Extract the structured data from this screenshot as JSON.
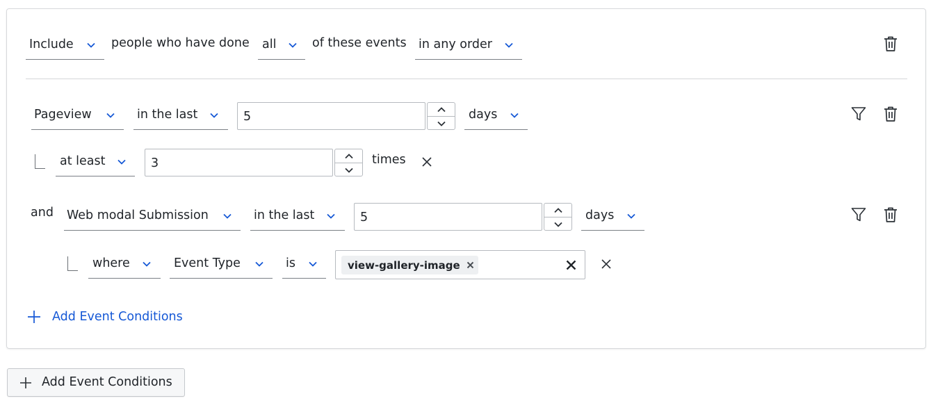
{
  "header": {
    "include_select": "Include",
    "text_people": "people who have done",
    "quantifier_select": "all",
    "text_events": "of these events",
    "order_select": "in any order"
  },
  "event1": {
    "event_select": "Pageview",
    "time_select": "in the last",
    "time_value": "5",
    "unit_select": "days",
    "frequency": {
      "operator_select": "at least",
      "count_value": "3",
      "suffix": "times"
    }
  },
  "event2": {
    "connector": "and",
    "event_select": "Web modal Submission",
    "time_select": "in the last",
    "time_value": "5",
    "unit_select": "days",
    "condition": {
      "where_select": "where",
      "property_select": "Event Type",
      "operator_select": "is",
      "chips": [
        "view-gallery-image"
      ]
    }
  },
  "inner_add_label": "Add Event Conditions",
  "outer_add_label": "Add Event Conditions",
  "colors": {
    "accent": "#1558d6",
    "text": "#1f2328",
    "border": "#b6babf"
  },
  "icons": [
    "chevron-down-icon",
    "trash-icon",
    "filter-icon",
    "close-icon",
    "plus-icon",
    "chevron-up-icon"
  ]
}
